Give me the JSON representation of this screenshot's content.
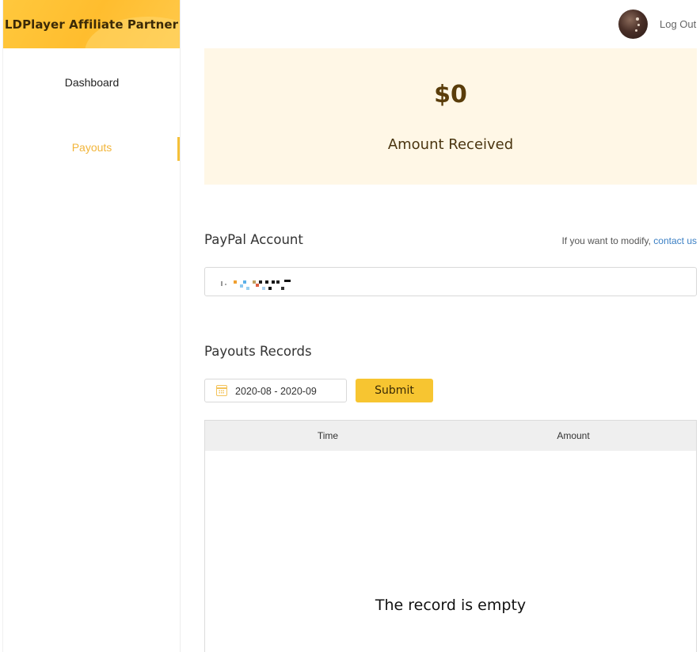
{
  "sidebar": {
    "brand_title": "LDPlayer Affiliate Partner",
    "items": [
      {
        "label": "Dashboard",
        "active": false
      },
      {
        "label": "Payouts",
        "active": true
      }
    ],
    "accent_color": "#f5c038"
  },
  "header": {
    "logout_label": "Log Out"
  },
  "amount_card": {
    "value": "$0",
    "label": "Amount Received"
  },
  "paypal": {
    "title": "PayPal Account",
    "modify_note": "If you want to modify,",
    "contact_link": "contact us"
  },
  "records": {
    "title": "Payouts Records",
    "date_range": "2020-08 - 2020-09",
    "submit_label": "Submit",
    "columns": [
      "Time",
      "Amount"
    ],
    "empty_message": "The record is empty"
  }
}
